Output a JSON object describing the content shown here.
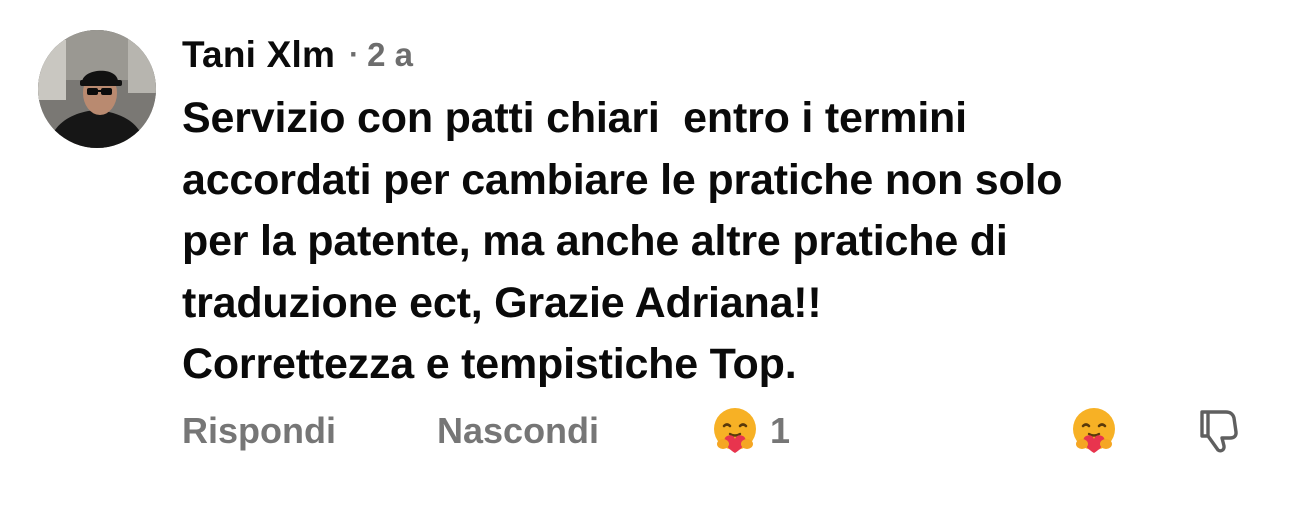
{
  "comment": {
    "author": "Tani Xlm",
    "separator": "·",
    "timestamp": "2 a",
    "text": "Servizio con patti chiari  entro i termini\naccordati per cambiare le pratiche non solo\nper la patente, ma anche altre pratiche di\ntraduzione ect, Grazie Adriana!!\nCorrettezza e tempistiche Top.",
    "avatar_icon": "profile-photo",
    "actions": {
      "reply_label": "Rispondi",
      "hide_label": "Nascondi"
    },
    "reactions": {
      "icon": "care-emoji-icon",
      "count": "1"
    },
    "react_button_icon": "care-emoji-icon",
    "dislike_icon": "thumbs-down-icon"
  },
  "colors": {
    "text": "#0a0a0a",
    "muted": "#767676",
    "emoji_face": "#f7b125",
    "emoji_heart": "#e8344e"
  }
}
